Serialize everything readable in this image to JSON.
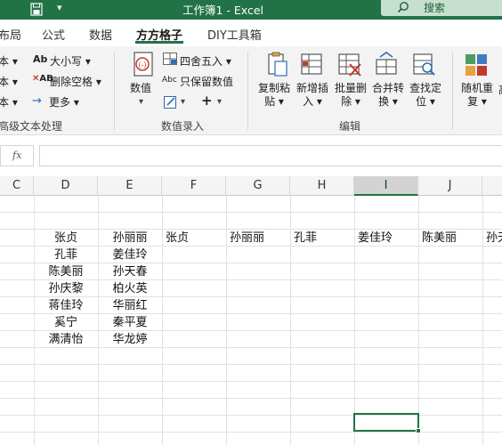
{
  "window": {
    "title": "工作簿1  -  Excel",
    "search_label": "搜索",
    "quick_access_more": "▾"
  },
  "menu": {
    "tabs": [
      "布局",
      "公式",
      "数据",
      "方方格子",
      "DIY工具箱"
    ],
    "active": "方方格子"
  },
  "ribbon": {
    "text_group": {
      "case_label": "大小写",
      "delete_space_label": "删除空格",
      "more_label": "更多",
      "left_dd": [
        "本 ▾",
        "本 ▾",
        "本 ▾"
      ],
      "group_label": "高级文本处理"
    },
    "number_group": {
      "number_label": "数值",
      "round_label": "四舍五入",
      "keep_value_label": "只保留数值",
      "plus_label": "+",
      "group_label": "数值录入"
    },
    "edit_group": {
      "copy_paste_label": "复制粘\n贴",
      "batch_insert_label": "新增插\n入",
      "batch_delete_label": "批量删\n除",
      "merge_convert_label": "合并转\n换",
      "find_locate_label": "查找定\n位",
      "group_label": "编辑"
    },
    "random_group": {
      "random_repeat_label": "随机重\n复",
      "cut_label": "高"
    }
  },
  "formula_bar": {
    "fx": "fx",
    "value": ""
  },
  "columns": [
    "C",
    "D",
    "E",
    "F",
    "G",
    "H",
    "I",
    "J"
  ],
  "selected_column": "I",
  "cells": {
    "D": [
      "张贞",
      "孔菲",
      "陈美丽",
      "孙庆黎",
      "蒋佳玲",
      "奚宁",
      "满清怡"
    ],
    "E": [
      "孙丽丽",
      "姜佳玲",
      "孙天春",
      "柏火英",
      "华丽红",
      "秦平夏",
      "华龙婷"
    ],
    "row_transposed": [
      "张贞",
      "孙丽丽",
      "孔菲",
      "姜佳玲",
      "陈美丽",
      "孙天"
    ]
  },
  "colors": {
    "accent": "#217346",
    "ribbon_bg": "#f3f3f3",
    "search_bg": "#c6e0cf"
  }
}
